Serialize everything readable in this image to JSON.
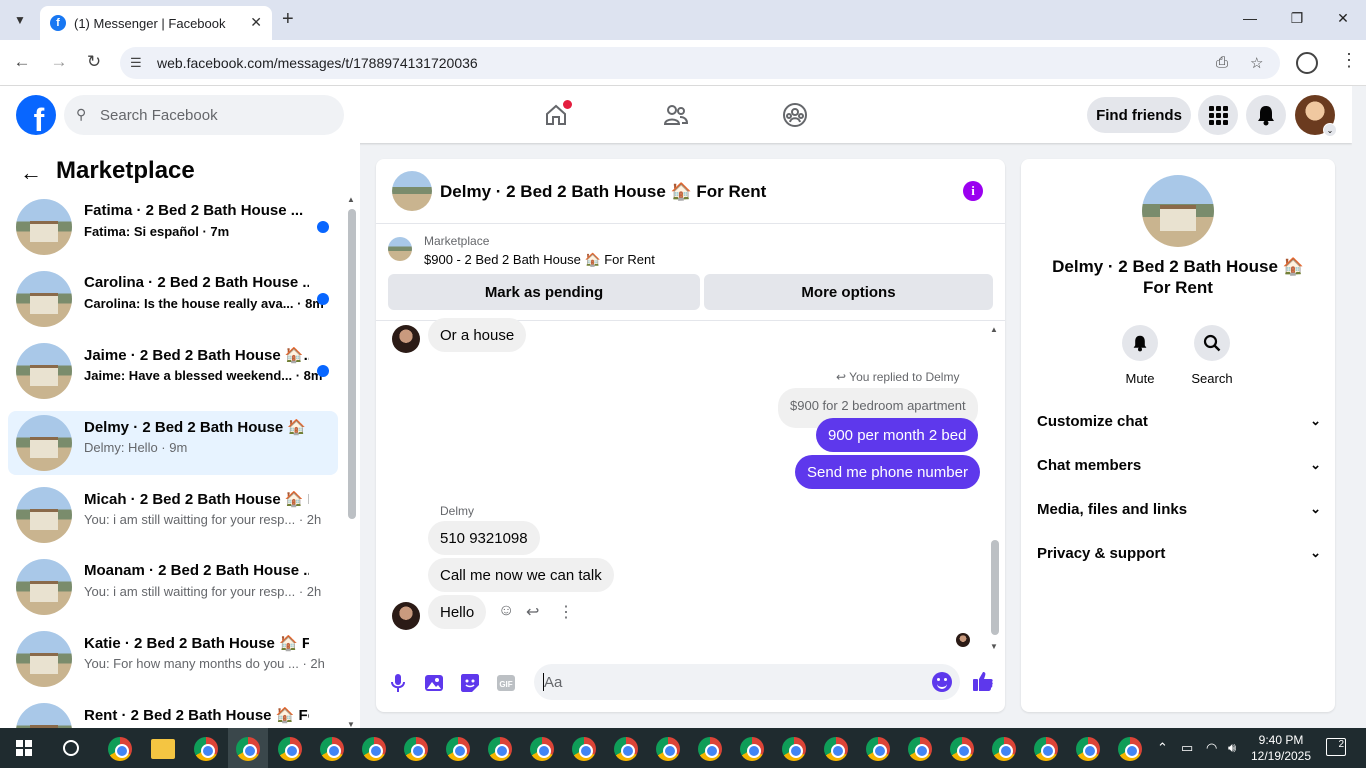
{
  "browser": {
    "tab_title": "(1) Messenger | Facebook",
    "favicon_letter": "f",
    "url": "web.facebook.com/messages/t/1788974131720036"
  },
  "fb_header": {
    "search_placeholder": "Search Facebook",
    "find_friends": "Find friends",
    "logo_letter": "f"
  },
  "sidebar": {
    "title": "Marketplace",
    "conversations": [
      {
        "name": "Fatima · 2 Bed 2 Bath House ...",
        "preview": "Fatima: Si español · 7m",
        "unread": true
      },
      {
        "name": "Carolina · 2 Bed 2 Bath House ...",
        "preview": "Carolina: Is the house really ava... · 8m",
        "unread": true
      },
      {
        "name": "Jaime · 2 Bed 2 Bath House 🏠...",
        "preview": "Jaime: Have a blessed weekend... · 8m",
        "unread": true
      },
      {
        "name": "Delmy · 2 Bed 2 Bath House 🏠 ...",
        "preview": "Delmy: Hello · 9m",
        "unread": false
      },
      {
        "name": "Micah · 2 Bed 2 Bath House 🏠 F...",
        "preview": "You: i am still waitting for your resp... · 2h",
        "unread": false
      },
      {
        "name": "Moanam · 2 Bed 2 Bath House ...",
        "preview": "You: i am still waitting for your resp... · 2h",
        "unread": false
      },
      {
        "name": "Katie · 2 Bed 2 Bath House 🏠 F...",
        "preview": "You: For how many months do you ... · 2h",
        "unread": false
      },
      {
        "name": "Rent · 2 Bed 2 Bath House 🏠 Fo...",
        "preview": "",
        "unread": false
      }
    ]
  },
  "chat": {
    "title": "Delmy · 2 Bed 2 Bath House 🏠 For Rent",
    "marketplace_label": "Marketplace",
    "listing": "$900 - 2 Bed 2 Bath House 🏠 For Rent",
    "mark_pending": "Mark as pending",
    "more_options": "More options",
    "messages": {
      "m1": "Or a house",
      "replied_to": "You replied to Delmy",
      "quoted": "$900 for 2 bedroom apartment",
      "out1": "900 per month 2 bed",
      "out2": "Send me phone number",
      "sender": "Delmy",
      "in1": "510 9321098",
      "in2": "Call me now we can talk",
      "in3": "Hello"
    },
    "composer_placeholder": "Aa"
  },
  "right_panel": {
    "name": "Delmy · 2 Bed 2 Bath House 🏠 For Rent",
    "mute": "Mute",
    "search": "Search",
    "sections": [
      "Customize chat",
      "Chat members",
      "Media, files and links",
      "Privacy & support"
    ]
  },
  "taskbar": {
    "time": "9:40 PM",
    "date": "12/19/2025",
    "notifications": "2"
  },
  "colors": {
    "fb_blue": "#0866ff",
    "outgoing_bubble": "#5e38ec",
    "info_purple": "#9b00f0"
  }
}
